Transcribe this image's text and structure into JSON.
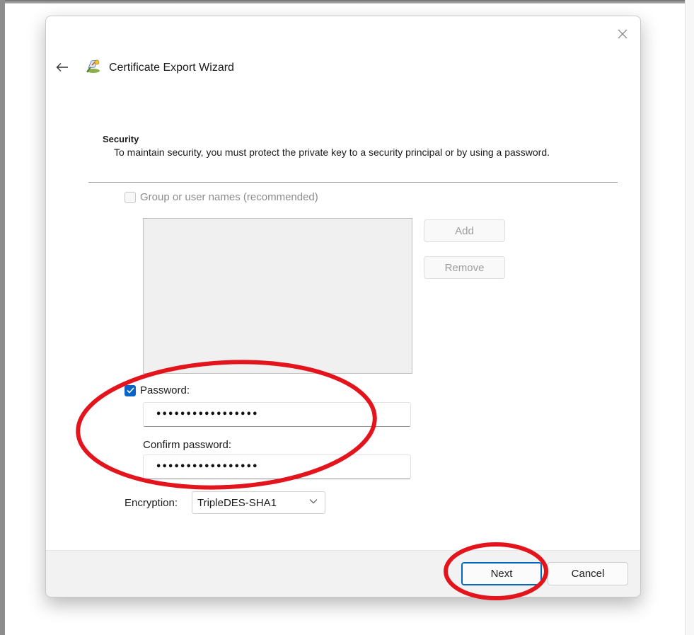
{
  "dialog": {
    "title": "Certificate Export Wizard",
    "close_icon": "close-icon",
    "back_icon": "back-arrow-icon",
    "title_icon": "certificate-wizard-icon"
  },
  "security": {
    "heading": "Security",
    "description": "To maintain security, you must protect the private key to a security principal or by using a password."
  },
  "group_option": {
    "label": "Group or user names (recommended)",
    "checked": false,
    "enabled": false
  },
  "principal_buttons": {
    "add_label": "Add",
    "remove_label": "Remove"
  },
  "password_option": {
    "label": "Password:",
    "checked": true
  },
  "password_field": {
    "value": "•••••••••••••••••"
  },
  "confirm": {
    "label": "Confirm password:",
    "value": "•••••••••••••••••"
  },
  "encryption": {
    "label": "Encryption:",
    "selected": "TripleDES-SHA1"
  },
  "footer": {
    "next_label": "Next",
    "cancel_label": "Cancel"
  },
  "colors": {
    "accent": "#0067c0",
    "annotation": "#e3141b"
  }
}
